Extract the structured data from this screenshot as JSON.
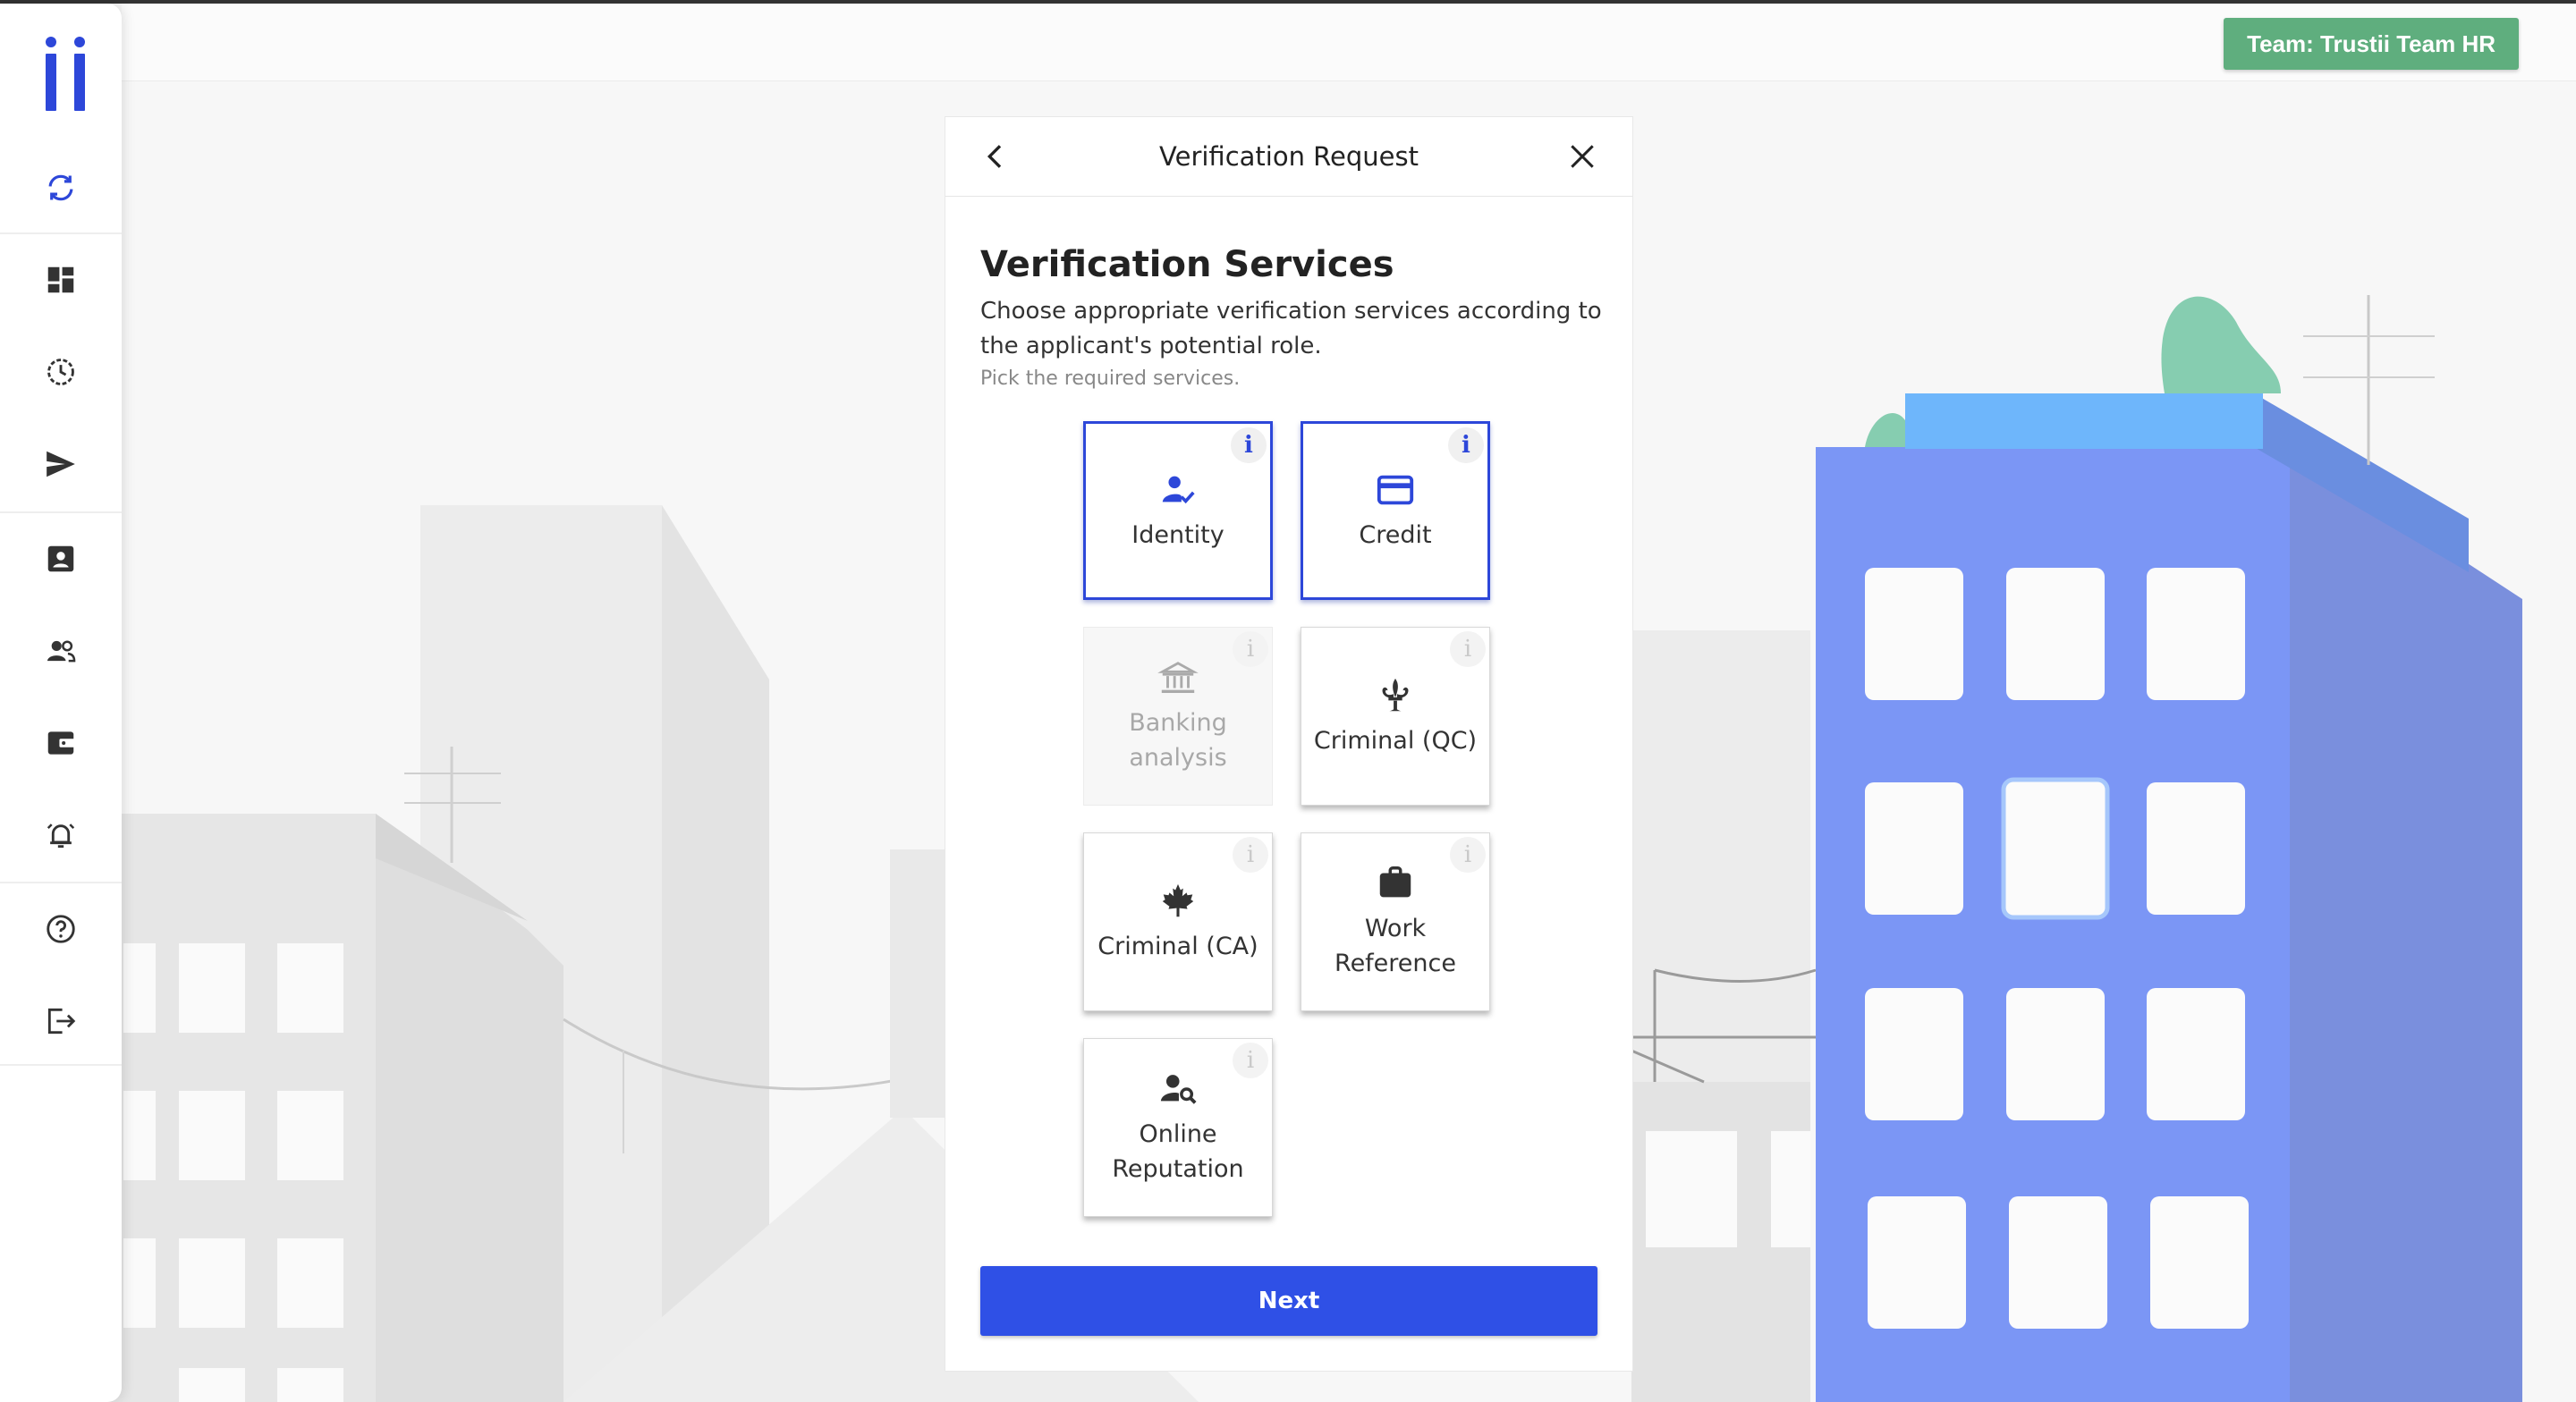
{
  "team_badge": "Team: Trustii Team HR",
  "sidebar": {
    "items": [
      {
        "icon": "refresh-icon"
      },
      {
        "icon": "dashboard-icon"
      },
      {
        "icon": "history-icon"
      },
      {
        "icon": "send-icon"
      },
      {
        "icon": "contact-card-icon"
      },
      {
        "icon": "people-icon"
      },
      {
        "icon": "wallet-icon"
      },
      {
        "icon": "alarm-icon"
      },
      {
        "icon": "help-icon"
      },
      {
        "icon": "logout-icon"
      }
    ]
  },
  "dialog": {
    "title": "Verification Request",
    "services_title": "Verification Services",
    "description": "Choose appropriate verification services according to the applicant's potential role.",
    "hint": "Pick the required services.",
    "next_label": "Next",
    "info_glyph": "i",
    "cards": [
      {
        "label": "Identity",
        "icon": "person-check-icon",
        "state": "selected"
      },
      {
        "label": "Credit",
        "icon": "credit-card-icon",
        "state": "selected"
      },
      {
        "label": "Banking analysis",
        "icon": "bank-icon",
        "state": "disabled"
      },
      {
        "label": "Criminal (QC)",
        "icon": "fleur-de-lis-icon",
        "state": "default"
      },
      {
        "label": "Criminal (CA)",
        "icon": "maple-leaf-icon",
        "state": "default"
      },
      {
        "label": "Work Reference",
        "icon": "briefcase-icon",
        "state": "default"
      },
      {
        "label": "Online Reputation",
        "icon": "person-search-icon",
        "state": "default"
      }
    ]
  },
  "colors": {
    "accent": "#2f50e6",
    "selected_border": "#2d47d9",
    "team_badge": "#5fae7e",
    "building_blue": "#7b96f5"
  }
}
